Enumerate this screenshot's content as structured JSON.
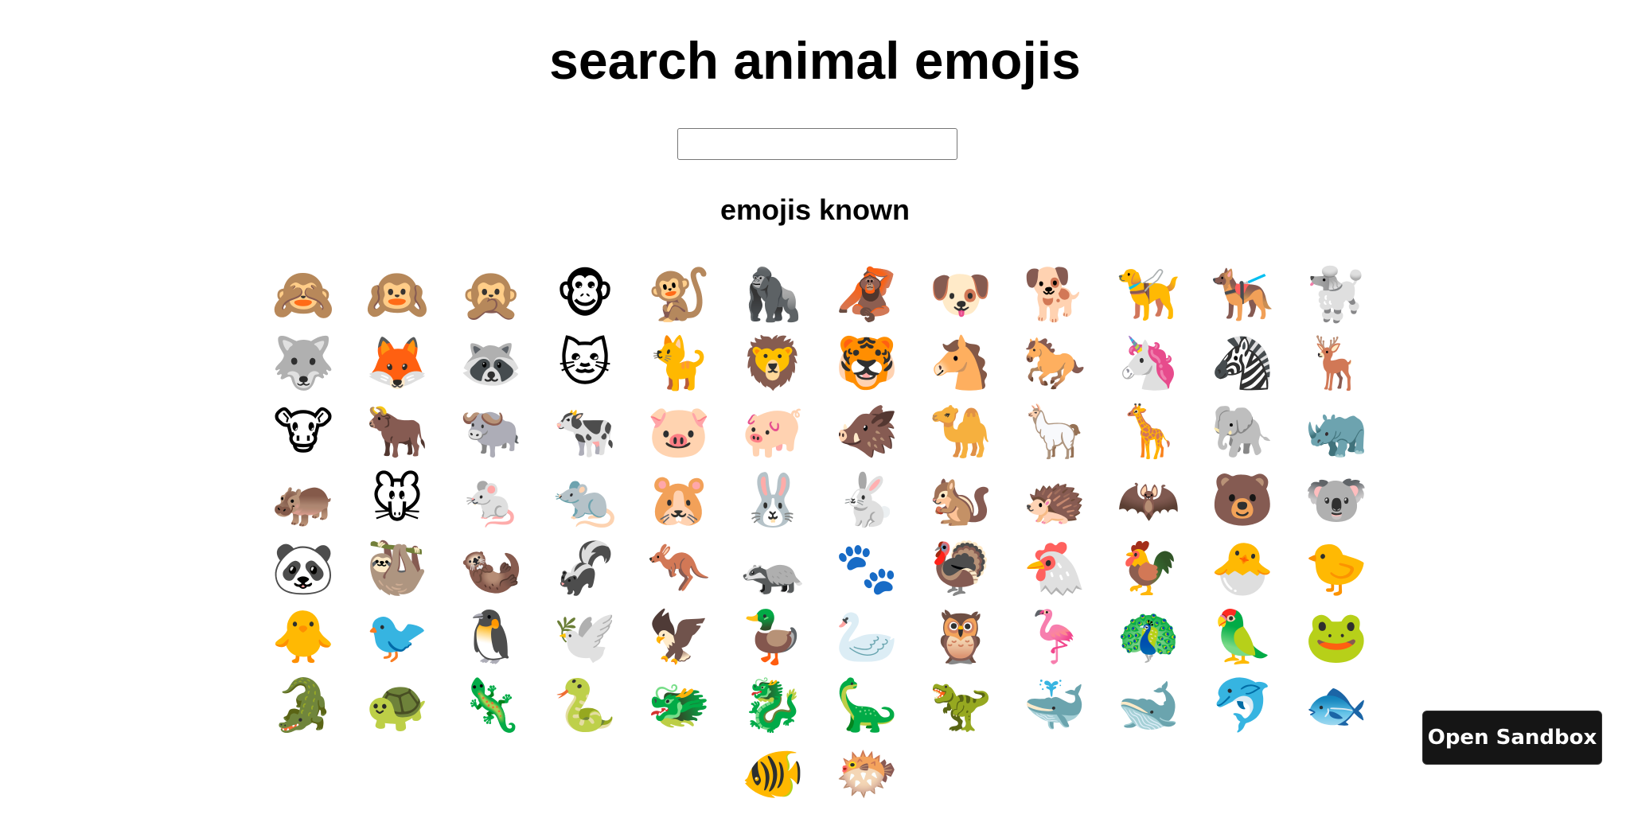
{
  "page": {
    "title": "search animal emojis",
    "subtitle": "emojis known"
  },
  "search": {
    "value": "",
    "placeholder": ""
  },
  "emojis": [
    {
      "symbol": "🙈",
      "name": "see-no-evil-monkey"
    },
    {
      "symbol": "🙉",
      "name": "hear-no-evil-monkey"
    },
    {
      "symbol": "🙊",
      "name": "speak-no-evil-monkey"
    },
    {
      "symbol": "🐵",
      "name": "monkey-face"
    },
    {
      "symbol": "🐒",
      "name": "monkey"
    },
    {
      "symbol": "🦍",
      "name": "gorilla"
    },
    {
      "symbol": "🦧",
      "name": "orangutan"
    },
    {
      "symbol": "🐶",
      "name": "dog-face"
    },
    {
      "symbol": "🐕",
      "name": "dog"
    },
    {
      "symbol": "🦮",
      "name": "guide-dog"
    },
    {
      "symbol": "🐕‍🦺",
      "name": "service-dog"
    },
    {
      "symbol": "🐩",
      "name": "poodle"
    },
    {
      "symbol": "🐺",
      "name": "wolf"
    },
    {
      "symbol": "🦊",
      "name": "fox"
    },
    {
      "symbol": "🦝",
      "name": "raccoon"
    },
    {
      "symbol": "🐱",
      "name": "cat-face"
    },
    {
      "symbol": "🐈",
      "name": "cat"
    },
    {
      "symbol": "🦁",
      "name": "lion"
    },
    {
      "symbol": "🐯",
      "name": "tiger-face"
    },
    {
      "symbol": "🐴",
      "name": "horse-face"
    },
    {
      "symbol": "🐎",
      "name": "horse"
    },
    {
      "symbol": "🦄",
      "name": "unicorn"
    },
    {
      "symbol": "🦓",
      "name": "zebra"
    },
    {
      "symbol": "🦌",
      "name": "deer"
    },
    {
      "symbol": "🐮",
      "name": "cow-face"
    },
    {
      "symbol": "🐂",
      "name": "ox"
    },
    {
      "symbol": "🐃",
      "name": "water-buffalo"
    },
    {
      "symbol": "🐄",
      "name": "cow"
    },
    {
      "symbol": "🐷",
      "name": "pig-face"
    },
    {
      "symbol": "🐖",
      "name": "pig"
    },
    {
      "symbol": "🐗",
      "name": "boar"
    },
    {
      "symbol": "🐪",
      "name": "camel"
    },
    {
      "symbol": "🦙",
      "name": "llama"
    },
    {
      "symbol": "🦒",
      "name": "giraffe"
    },
    {
      "symbol": "🐘",
      "name": "elephant"
    },
    {
      "symbol": "🦏",
      "name": "rhinoceros"
    },
    {
      "symbol": "🦛",
      "name": "hippopotamus"
    },
    {
      "symbol": "🐭",
      "name": "mouse-face"
    },
    {
      "symbol": "🐁",
      "name": "mouse"
    },
    {
      "symbol": "🐀",
      "name": "rat"
    },
    {
      "symbol": "🐹",
      "name": "hamster"
    },
    {
      "symbol": "🐰",
      "name": "rabbit-face"
    },
    {
      "symbol": "🐇",
      "name": "rabbit"
    },
    {
      "symbol": "🐿️",
      "name": "chipmunk"
    },
    {
      "symbol": "🦔",
      "name": "hedgehog"
    },
    {
      "symbol": "🦇",
      "name": "bat"
    },
    {
      "symbol": "🐻",
      "name": "bear"
    },
    {
      "symbol": "🐨",
      "name": "koala"
    },
    {
      "symbol": "🐼",
      "name": "panda"
    },
    {
      "symbol": "🦥",
      "name": "sloth"
    },
    {
      "symbol": "🦦",
      "name": "otter"
    },
    {
      "symbol": "🦨",
      "name": "skunk"
    },
    {
      "symbol": "🦘",
      "name": "kangaroo"
    },
    {
      "symbol": "🦡",
      "name": "badger"
    },
    {
      "symbol": "🐾",
      "name": "paw-prints"
    },
    {
      "symbol": "🦃",
      "name": "turkey"
    },
    {
      "symbol": "🐔",
      "name": "chicken"
    },
    {
      "symbol": "🐓",
      "name": "rooster"
    },
    {
      "symbol": "🐣",
      "name": "hatching-chick"
    },
    {
      "symbol": "🐤",
      "name": "baby-chick"
    },
    {
      "symbol": "🐥",
      "name": "front-facing-baby-chick"
    },
    {
      "symbol": "🐦",
      "name": "bird"
    },
    {
      "symbol": "🐧",
      "name": "penguin"
    },
    {
      "symbol": "🕊️",
      "name": "dove"
    },
    {
      "symbol": "🦅",
      "name": "eagle"
    },
    {
      "symbol": "🦆",
      "name": "duck"
    },
    {
      "symbol": "🦢",
      "name": "swan"
    },
    {
      "symbol": "🦉",
      "name": "owl"
    },
    {
      "symbol": "🦩",
      "name": "flamingo"
    },
    {
      "symbol": "🦚",
      "name": "peacock"
    },
    {
      "symbol": "🦜",
      "name": "parrot"
    },
    {
      "symbol": "🐸",
      "name": "frog"
    },
    {
      "symbol": "🐊",
      "name": "crocodile"
    },
    {
      "symbol": "🐢",
      "name": "turtle"
    },
    {
      "symbol": "🦎",
      "name": "lizard"
    },
    {
      "symbol": "🐍",
      "name": "snake"
    },
    {
      "symbol": "🐲",
      "name": "dragon-face"
    },
    {
      "symbol": "🐉",
      "name": "dragon"
    },
    {
      "symbol": "🦕",
      "name": "sauropod"
    },
    {
      "symbol": "🦖",
      "name": "t-rex"
    },
    {
      "symbol": "🐳",
      "name": "spouting-whale"
    },
    {
      "symbol": "🐋",
      "name": "whale"
    },
    {
      "symbol": "🐬",
      "name": "dolphin"
    },
    {
      "symbol": "🐟",
      "name": "fish"
    },
    {
      "symbol": "🐠",
      "name": "tropical-fish"
    },
    {
      "symbol": "🐡",
      "name": "blowfish"
    }
  ],
  "sandbox": {
    "label": "Open Sandbox"
  }
}
